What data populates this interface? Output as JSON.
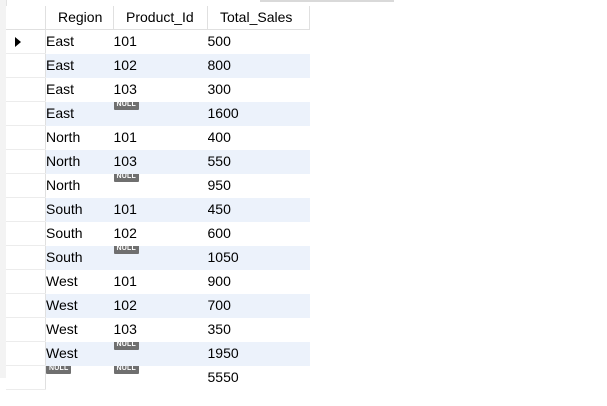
{
  "grid": {
    "columns": [
      "Region",
      "Product_Id",
      "Total_Sales"
    ],
    "null_label": "NULL",
    "rows": [
      {
        "Region": "East",
        "Product_Id": "101",
        "Total_Sales": "500"
      },
      {
        "Region": "East",
        "Product_Id": "102",
        "Total_Sales": "800"
      },
      {
        "Region": "East",
        "Product_Id": "103",
        "Total_Sales": "300"
      },
      {
        "Region": "East",
        "Product_Id": null,
        "Total_Sales": "1600"
      },
      {
        "Region": "North",
        "Product_Id": "101",
        "Total_Sales": "400"
      },
      {
        "Region": "North",
        "Product_Id": "103",
        "Total_Sales": "550"
      },
      {
        "Region": "North",
        "Product_Id": null,
        "Total_Sales": "950"
      },
      {
        "Region": "South",
        "Product_Id": "101",
        "Total_Sales": "450"
      },
      {
        "Region": "South",
        "Product_Id": "102",
        "Total_Sales": "600"
      },
      {
        "Region": "South",
        "Product_Id": null,
        "Total_Sales": "1050"
      },
      {
        "Region": "West",
        "Product_Id": "101",
        "Total_Sales": "900"
      },
      {
        "Region": "West",
        "Product_Id": "102",
        "Total_Sales": "700"
      },
      {
        "Region": "West",
        "Product_Id": "103",
        "Total_Sales": "350"
      },
      {
        "Region": "West",
        "Product_Id": null,
        "Total_Sales": "1950"
      },
      {
        "Region": null,
        "Product_Id": null,
        "Total_Sales": "5550"
      }
    ],
    "selected_row": 0,
    "colors": {
      "alt_row": "#ecf2fb",
      "null_badge_bg": "#6f6f6f",
      "null_badge_fg": "#ffffff",
      "gridline": "#e0e0e0"
    },
    "icons": {
      "row_pointer": "current-row-arrow-icon"
    }
  }
}
